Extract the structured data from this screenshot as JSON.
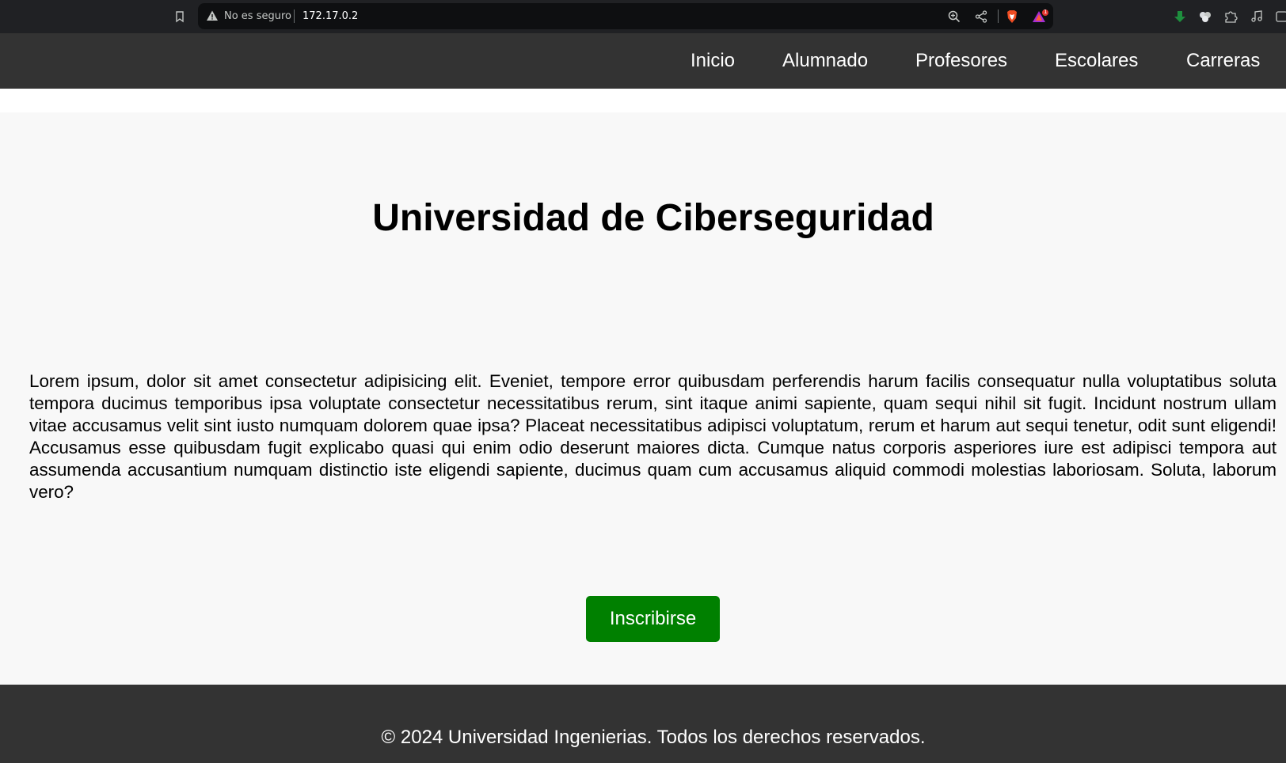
{
  "browser": {
    "security_label": "No es seguro",
    "url": "172.17.0.2",
    "icons": [
      "bookmark-icon",
      "warning-icon",
      "zoom-icon",
      "share-icon",
      "brave-shield-icon",
      "brave-rewards-icon",
      "download-icon",
      "wallet-icon",
      "extensions-icon",
      "media-icon",
      "sidebar-icon"
    ],
    "rewards_badge": "1"
  },
  "nav": {
    "items": [
      {
        "label": "Inicio"
      },
      {
        "label": "Alumnado"
      },
      {
        "label": "Profesores"
      },
      {
        "label": "Escolares"
      },
      {
        "label": "Carreras"
      }
    ]
  },
  "main": {
    "title": "Universidad de Ciberseguridad",
    "body": "Lorem ipsum, dolor sit amet consectetur adipisicing elit. Eveniet, tempore error quibusdam perferendis harum facilis consequatur nulla voluptatibus soluta tempora ducimus temporibus ipsa voluptate consectetur necessitatibus rerum, sint itaque animi sapiente, quam sequi nihil sit fugit. Incidunt nostrum ullam vitae accusamus velit sint iusto numquam dolorem quae ipsa? Placeat necessitatibus adipisci voluptatum, rerum et harum aut sequi tenetur, odit sunt eligendi! Accusamus esse quibusdam fugit explicabo quasi qui enim odio deserunt maiores dicta. Cumque natus corporis asperiores iure est adipisci tempora aut assumenda accusantium numquam distinctio iste eligendi sapiente, ducimus quam cum accusamus aliquid commodi molestias laboriosam. Soluta, laborum vero?",
    "cta_label": "Inscribirse"
  },
  "footer": {
    "text": "© 2024 Universidad Ingenierias. Todos los derechos reservados."
  },
  "colors": {
    "nav_bg": "#333333",
    "page_bg": "#f8f8f8",
    "cta_bg": "#008000",
    "chrome_bg": "#202124"
  }
}
